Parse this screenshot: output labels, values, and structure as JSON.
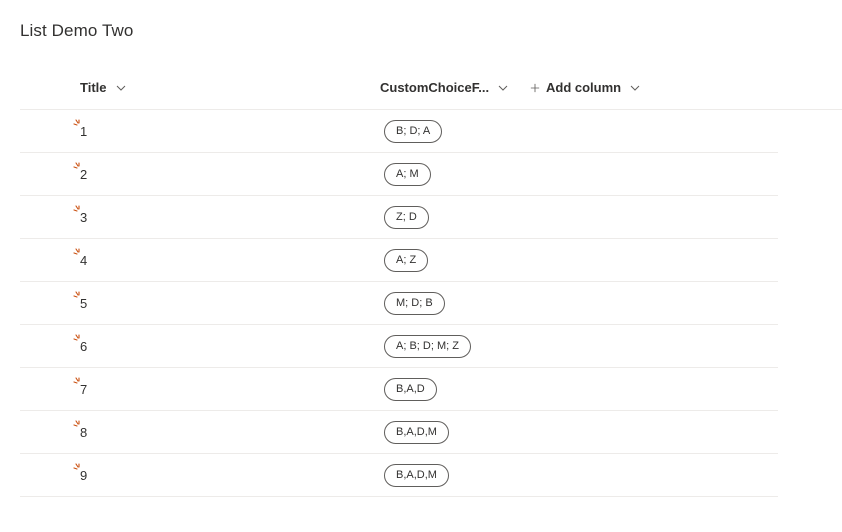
{
  "list": {
    "title": "List Demo Two"
  },
  "columns": {
    "title_label": "Title",
    "choice_label": "CustomChoiceF...",
    "add_label": "Add column"
  },
  "rows": [
    {
      "title": "1",
      "choice": "B; D; A"
    },
    {
      "title": "2",
      "choice": "A; M"
    },
    {
      "title": "3",
      "choice": "Z; D"
    },
    {
      "title": "4",
      "choice": "A; Z"
    },
    {
      "title": "5",
      "choice": "M; D; B"
    },
    {
      "title": "6",
      "choice": "A; B; D; M; Z"
    },
    {
      "title": "7",
      "choice": "B,A,D"
    },
    {
      "title": "8",
      "choice": "B,A,D,M"
    },
    {
      "title": "9",
      "choice": "B,A,D,M"
    }
  ],
  "icons": {
    "new_item": "new-item-sparkle-icon",
    "sort": "chevron-down-icon",
    "add": "plus-icon"
  },
  "colors": {
    "new_item_accent": "#ca5010",
    "divider": "#edebe9",
    "text": "#323130"
  }
}
